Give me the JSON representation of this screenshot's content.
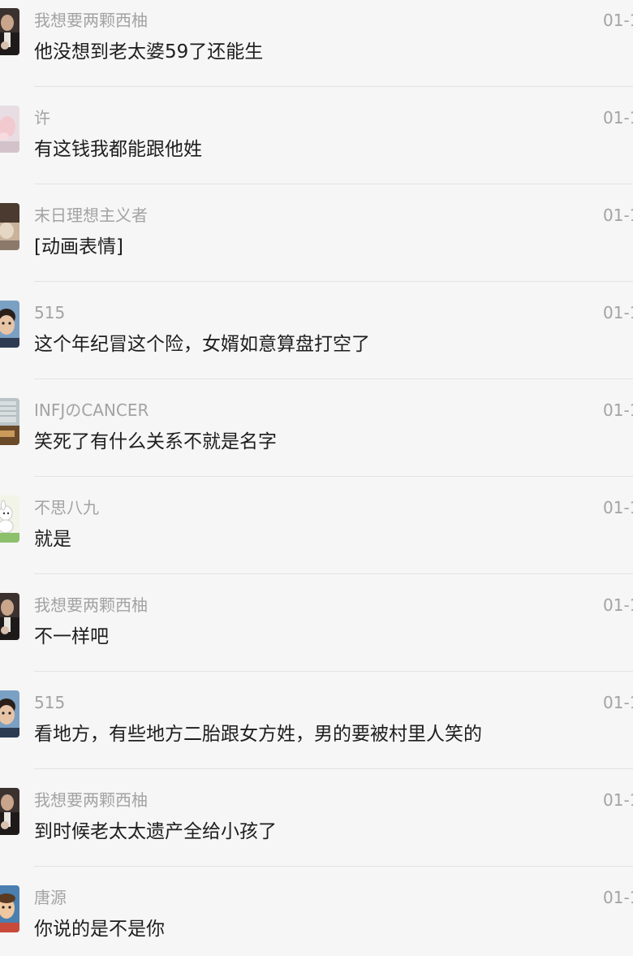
{
  "comments": [
    {
      "name": "我想要两颗西柚",
      "time": "01-1",
      "text": "他没想到老太婆59了还能生",
      "avatar": "man-in-suit-avatar"
    },
    {
      "name": "许",
      "time": "01-1",
      "text": "有这钱我都能跟他姓",
      "avatar": "baby-avatar"
    },
    {
      "name": "末日理想主义者",
      "time": "01-1",
      "text": "[动画表情]",
      "avatar": "cat-avatar"
    },
    {
      "name": "515",
      "time": "01-1",
      "text": "这个年纪冒这个险，女婿如意算盘打空了",
      "avatar": "child-avatar"
    },
    {
      "name": "INFJのCANCER",
      "time": "01-1",
      "text": "笑死了有什么关系不就是名字",
      "avatar": "building-avatar"
    },
    {
      "name": "不思八九",
      "time": "01-1",
      "text": "就是",
      "avatar": "rabbit-cartoon-avatar"
    },
    {
      "name": "我想要两颗西柚",
      "time": "01-1",
      "text": "不一样吧",
      "avatar": "man-in-suit-avatar"
    },
    {
      "name": "515",
      "time": "01-1",
      "text": "看地方，有些地方二胎跟女方姓，男的要被村里人笑的",
      "avatar": "child-avatar"
    },
    {
      "name": "我想要两颗西柚",
      "time": "01-1",
      "text": "到时候老太太遗产全给小孩了",
      "avatar": "man-in-suit-avatar"
    },
    {
      "name": "唐源",
      "time": "01-1",
      "text": "你说的是不是你",
      "avatar": "cartoon-face-avatar"
    }
  ]
}
